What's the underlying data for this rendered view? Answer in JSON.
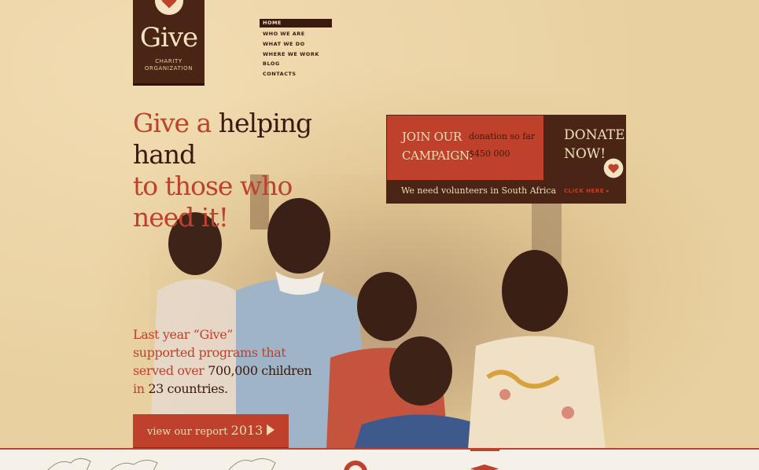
{
  "brand": {
    "name": "Give",
    "subtitle_line1": "CHARITY",
    "subtitle_line2": "ORGANIZATION",
    "accent_color": "#c0412b",
    "dark_color": "#4a2414"
  },
  "nav": {
    "items": [
      {
        "label": "HOME",
        "active": true
      },
      {
        "label": "WHO WE ARE"
      },
      {
        "label": "WHAT WE DO"
      },
      {
        "label": "WHERE WE WORK"
      },
      {
        "label": "BLOG"
      },
      {
        "label": "CONTACTS"
      }
    ]
  },
  "hero": {
    "headline_red_1": "Give a",
    "headline_dark": "helping hand",
    "headline_red_2": "to those who",
    "headline_red_3": "need it!"
  },
  "campaign": {
    "join_line1": "JOIN OUR",
    "join_line2": "CAMPAIGN:",
    "donation_label": "donation so far",
    "donation_amount": "$450 000",
    "donate_line1": "DONATE",
    "donate_line2": "NOW!",
    "volunteers_text": "We need volunteers in South Africa",
    "click_here": "CLICK HERE"
  },
  "stats": {
    "line1": "Last year “Give”",
    "line2": "supported programs that",
    "line3_red": "served over",
    "line3_dark": "700,000 children",
    "line4_red": "in",
    "line4_dark": "23 countries."
  },
  "report_button": {
    "label": "view our report",
    "year": "2013"
  },
  "icons": [
    "heart-icon",
    "arrow-right-icon",
    "lifebuoy-icon",
    "graduation-cap-icon",
    "world-map-icon"
  ]
}
